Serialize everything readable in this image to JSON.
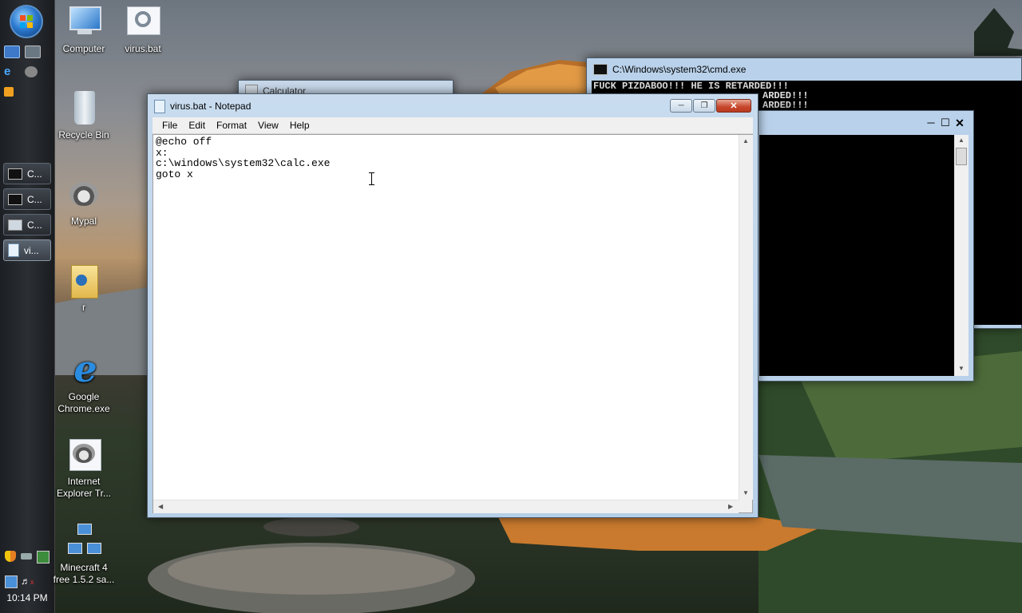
{
  "taskbar": {
    "buttons": [
      {
        "label": "C..."
      },
      {
        "label": "C..."
      },
      {
        "label": "C..."
      },
      {
        "label": "vi..."
      }
    ],
    "clock": "10:14 PM"
  },
  "desktop": {
    "icons": [
      {
        "label": "Computer"
      },
      {
        "label": "virus.bat"
      },
      {
        "label": "Recycle Bin"
      },
      {
        "label": "Mypal"
      },
      {
        "label": "r"
      },
      {
        "label": "Google Chrome.exe"
      },
      {
        "label": "Internet Explorer Tr..."
      },
      {
        "label": "Minecraft 4 free 1.5.2 sa..."
      }
    ]
  },
  "cmd": {
    "title": "C:\\Windows\\system32\\cmd.exe",
    "lines": [
      "FUCK PIZDABOO!!! HE IS RETARDED!!!",
      "ARDED!!!",
      "ARDED!!!"
    ]
  },
  "behind_window": {
    "title": "Calculator"
  },
  "notepad": {
    "title": "virus.bat - Notepad",
    "menu": [
      "File",
      "Edit",
      "Format",
      "View",
      "Help"
    ],
    "content": "@echo off\nx:\nc:\\windows\\system32\\calc.exe\ngoto x"
  }
}
